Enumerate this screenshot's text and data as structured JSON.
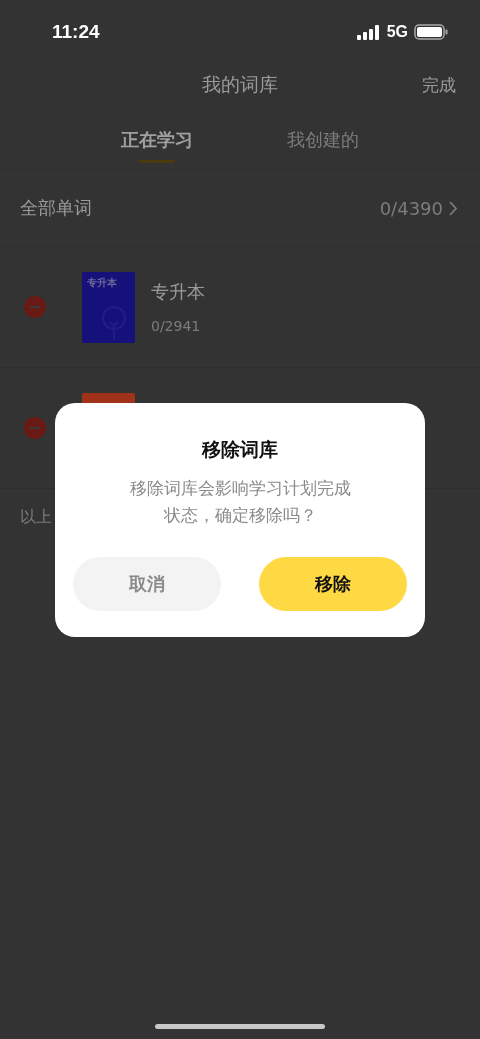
{
  "status_bar": {
    "time": "11:24",
    "network": "5G"
  },
  "nav": {
    "title": "我的词库",
    "action": "完成"
  },
  "tabs": [
    {
      "label": "正在学习",
      "selected": true
    },
    {
      "label": "我创建的",
      "selected": false
    }
  ],
  "all_words": {
    "label": "全部单词",
    "count": "0/4390"
  },
  "books": [
    {
      "kind": "shown",
      "title": "专升本",
      "progress": "0/2941",
      "cover_label": "专升本"
    },
    {
      "kind": "covered"
    }
  ],
  "footer_note": "以上",
  "dialog": {
    "title": "移除词库",
    "message": "移除词库会影响学习计划完成状态，确定移除吗？",
    "buttons": [
      {
        "label": "取消",
        "kind": "cancel"
      },
      {
        "label": "移除",
        "kind": "confirm"
      }
    ]
  }
}
